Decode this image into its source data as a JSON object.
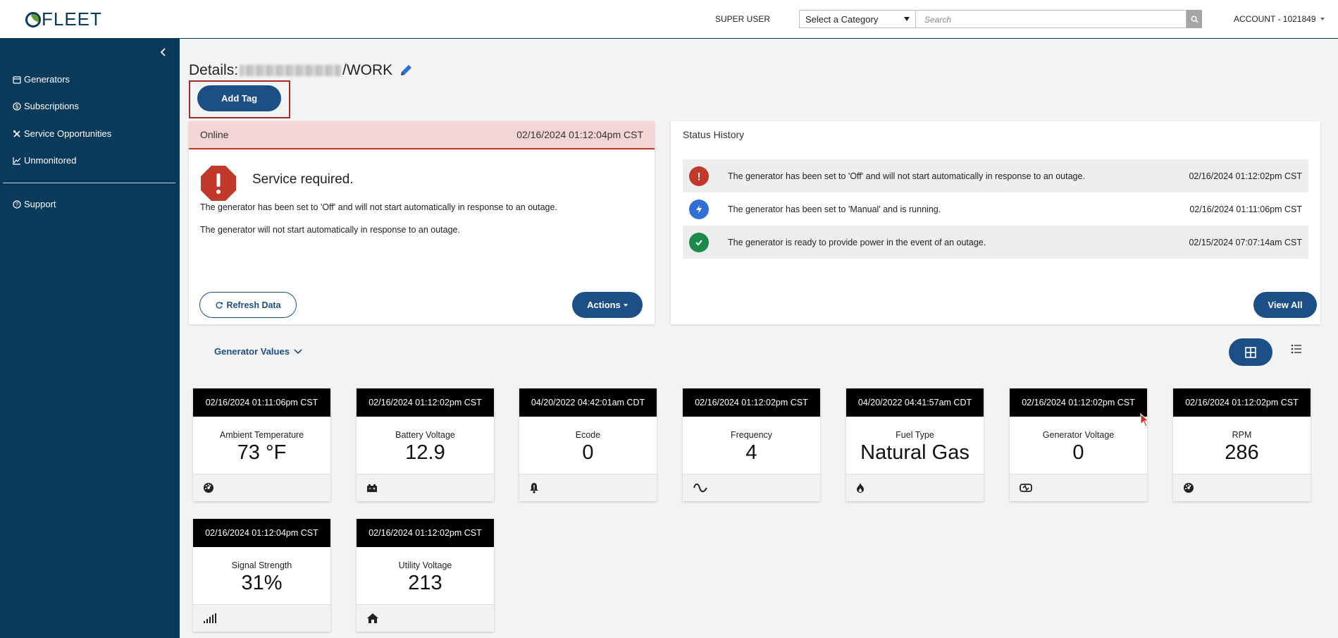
{
  "header": {
    "logo_text": "FLEET",
    "user_role": "SUPER USER",
    "category_select": "Select a Category",
    "search_placeholder": "Search",
    "account_label": "ACCOUNT - 1021849"
  },
  "sidebar": {
    "items": [
      {
        "label": "Generators",
        "icon": "calendar-icon"
      },
      {
        "label": "Subscriptions",
        "icon": "dollar-circle-icon"
      },
      {
        "label": "Service Opportunities",
        "icon": "tools-icon"
      },
      {
        "label": "Unmonitored",
        "icon": "line-chart-icon"
      }
    ],
    "support": {
      "label": "Support",
      "icon": "question-circle-icon"
    }
  },
  "page": {
    "title_prefix": "Details: ",
    "title_suffix": "/WORK",
    "add_tag_label": "Add Tag"
  },
  "status_card": {
    "state": "Online",
    "timestamp": "02/16/2024 01:12:04pm CST",
    "headline": "Service required.",
    "messages": [
      "The generator has been set to 'Off' and will not start automatically in response to an outage.",
      "The generator will not start automatically in response to an outage."
    ],
    "refresh_label": "Refresh Data",
    "actions_label": "Actions"
  },
  "history": {
    "title": "Status History",
    "rows": [
      {
        "icon": "alert-octagon-icon",
        "color": "#c0392b",
        "text": "The generator has been set to 'Off' and will not start automatically in response to an outage.",
        "time": "02/16/2024 01:12:02pm CST"
      },
      {
        "icon": "lightning-icon",
        "color": "#2f6fd6",
        "text": "The generator has been set to 'Manual' and is running.",
        "time": "02/16/2024 01:11:06pm CST"
      },
      {
        "icon": "check-circle-icon",
        "color": "#1e8a4a",
        "text": "The generator is ready to provide power in the event of an outage.",
        "time": "02/15/2024 07:07:14am CST"
      }
    ],
    "view_all_label": "View All"
  },
  "gen_values": {
    "label": "Generator Values",
    "tiles": [
      {
        "time": "02/16/2024 01:11:06pm CST",
        "label": "Ambient Temperature",
        "value": "73 °F",
        "icon": "gauge-icon"
      },
      {
        "time": "02/16/2024 01:12:02pm CST",
        "label": "Battery Voltage",
        "value": "12.9",
        "icon": "battery-icon"
      },
      {
        "time": "04/20/2022 04:42:01am CDT",
        "label": "Ecode",
        "value": "0",
        "icon": "bell-icon"
      },
      {
        "time": "02/16/2024 01:12:02pm CST",
        "label": "Frequency",
        "value": "4",
        "icon": "sine-wave-icon"
      },
      {
        "time": "04/20/2022 04:41:57am CDT",
        "label": "Fuel Type",
        "value": "Natural Gas",
        "icon": "flame-icon"
      },
      {
        "time": "02/16/2024 01:12:02pm CST",
        "label": "Generator Voltage",
        "value": "0",
        "icon": "car-battery-icon"
      },
      {
        "time": "02/16/2024 01:12:02pm CST",
        "label": "RPM",
        "value": "286",
        "icon": "gauge-icon"
      },
      {
        "time": "02/16/2024 01:12:04pm CST",
        "label": "Signal Strength",
        "value": "31%",
        "icon": "signal-icon"
      },
      {
        "time": "02/16/2024 01:12:02pm CST",
        "label": "Utility Voltage",
        "value": "213",
        "icon": "house-icon"
      }
    ]
  },
  "colors": {
    "sidebar_bg": "#0a3a5a",
    "primary": "#1c4f86",
    "alert_red": "#c0392b",
    "status_head_bg": "#f4d4d4"
  }
}
